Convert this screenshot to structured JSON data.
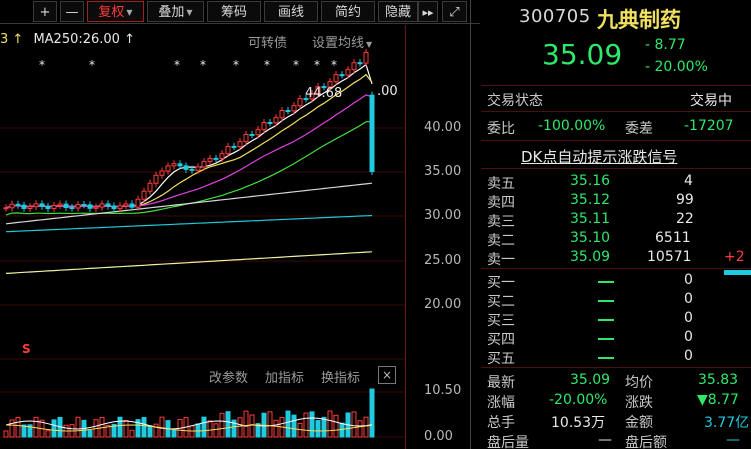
{
  "toolbar": {
    "plus": "+",
    "minus": "—",
    "fuquan": "复权",
    "diejia": "叠加",
    "chouma": "筹码",
    "huaxian": "画线",
    "jianyue": "简约",
    "yincang": "隐藏",
    "play": "▸▸",
    "expand": "⤢"
  },
  "chart": {
    "ma_label": "MA250:26.00",
    "convertible_bond": "可转债",
    "set_ma": "设置均线",
    "high_label": "44.68",
    "y_ticks": [
      "40.00",
      "35.00",
      "30.00",
      "25.00",
      "20.00"
    ],
    "s_marker": "S",
    "sub_change_params": "改参数",
    "sub_add_indicator": "加指标",
    "sub_switch_indicator": "换指标",
    "sub_close": "×",
    "sub_y_ticks": [
      "10.50",
      "0.00"
    ]
  },
  "stock": {
    "code": "300705",
    "name": "九典制药",
    "price": "35.09",
    "change": "- 8.77",
    "change_pct": "- 20.00%"
  },
  "status": {
    "trade_status_label": "交易状态",
    "trade_status_value": "交易中",
    "weibi_label": "委比",
    "weibi_value": "-100.00%",
    "weicha_label": "委差",
    "weicha_value": "-17207"
  },
  "dk_signal": "DK点自动提示涨跌信号",
  "order_book": {
    "asks": [
      {
        "label": "卖五",
        "price": "35.16",
        "volume": "4",
        "delta": ""
      },
      {
        "label": "卖四",
        "price": "35.12",
        "volume": "99",
        "delta": ""
      },
      {
        "label": "卖三",
        "price": "35.11",
        "volume": "22",
        "delta": ""
      },
      {
        "label": "卖二",
        "price": "35.10",
        "volume": "6511",
        "delta": ""
      },
      {
        "label": "卖一",
        "price": "35.09",
        "volume": "10571",
        "delta": "+2"
      }
    ],
    "bids": [
      {
        "label": "买一",
        "volume": "0"
      },
      {
        "label": "买二",
        "volume": "0"
      },
      {
        "label": "买三",
        "volume": "0"
      },
      {
        "label": "买四",
        "volume": "0"
      },
      {
        "label": "买五",
        "volume": "0"
      }
    ]
  },
  "quote": {
    "latest_label": "最新",
    "latest_value": "35.09",
    "avg_label": "均价",
    "avg_value": "35.83",
    "zf_label": "涨幅",
    "zf_value": "-20.00%",
    "zd_label": "涨跌",
    "zd_value": "▼8.77",
    "zs_label": "总手",
    "zs_value": "10.53万",
    "je_label": "金额",
    "je_value": "3.77亿",
    "phl_label": "盘后量",
    "phl_value": "—",
    "phe_label": "盘后额",
    "phe_value": "—"
  },
  "colors": {
    "up": "#ff3c3c",
    "down": "#2ee86a",
    "volume_down": "#1ecbe1",
    "ma5": "#ffffff",
    "ma10": "#f0e060",
    "ma20": "#e040e0",
    "ma30": "#40e040",
    "ma60": "#d8d8d8",
    "ma120": "#20c8d8",
    "ma250": "#f0f0a0"
  }
}
